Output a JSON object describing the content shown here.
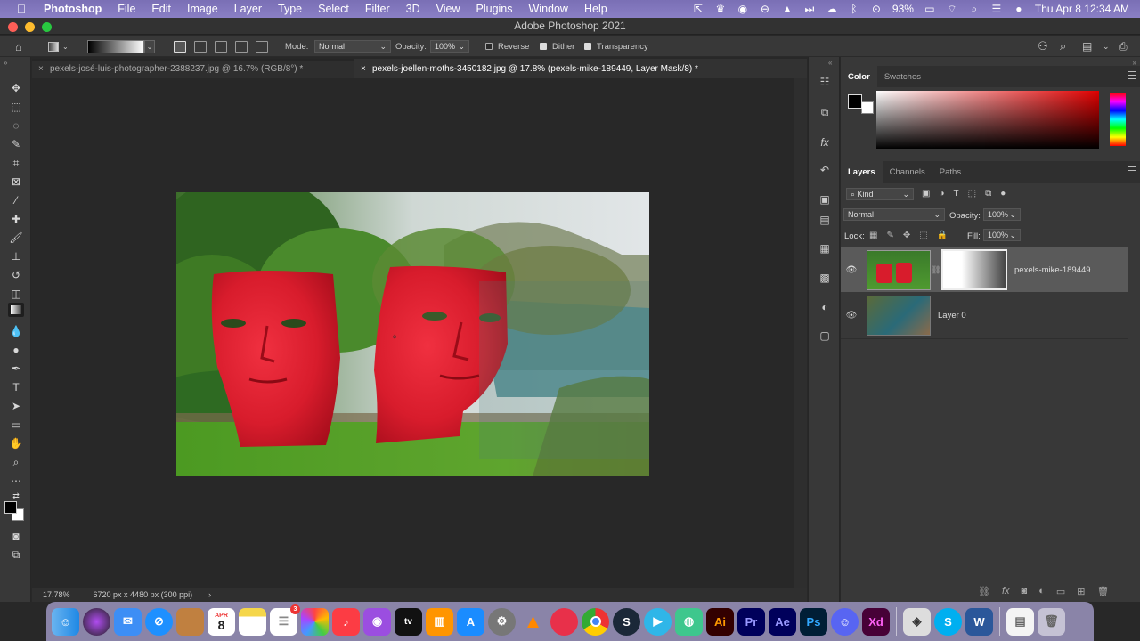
{
  "menubar": {
    "app": "Photoshop",
    "items": [
      "File",
      "Edit",
      "Image",
      "Layer",
      "Type",
      "Select",
      "Filter",
      "3D",
      "View",
      "Plugins",
      "Window",
      "Help"
    ],
    "battery": "93%",
    "datetime": "Thu Apr 8  12:34 AM"
  },
  "window": {
    "title": "Adobe Photoshop 2021"
  },
  "options": {
    "mode_label": "Mode:",
    "mode_value": "Normal",
    "opacity_label": "Opacity:",
    "opacity_value": "100%",
    "reverse": "Reverse",
    "dither": "Dither",
    "transparency": "Transparency",
    "reverse_checked": false,
    "dither_checked": true,
    "transparency_checked": true
  },
  "tabs": [
    {
      "label": "pexels-josé-luis-photographer-2388237.jpg @ 16.7% (RGB/8°) *"
    },
    {
      "label": "pexels-joellen-moths-3450182.jpg @ 17.8% (pexels-mike-189449, Layer Mask/8) *"
    }
  ],
  "status": {
    "zoom": "17.78%",
    "doc_info": "6720 px x 4480 px (300 ppi)",
    "arrow": "›"
  },
  "color_panel": {
    "tabs": [
      "Color",
      "Swatches"
    ],
    "active": "Color"
  },
  "layers_panel": {
    "tabs": [
      "Layers",
      "Channels",
      "Paths"
    ],
    "active": "Layers",
    "kind": "Kind",
    "blend": "Normal",
    "opacity_label": "Opacity:",
    "opacity_value": "100%",
    "lock_label": "Lock:",
    "fill_label": "Fill:",
    "fill_value": "100%",
    "layers": [
      {
        "name": "pexels-mike-189449",
        "selected": true
      },
      {
        "name": "Layer 0",
        "selected": false
      }
    ]
  },
  "dock": {
    "calendar_month": "APR",
    "calendar_day": "8",
    "reminders_badge": "3",
    "apps": [
      "Finder",
      "Siri",
      "Mail",
      "Safari",
      "Pages",
      "Calendar",
      "Notes",
      "Reminders",
      "Photos",
      "Music",
      "Podcasts",
      "TV",
      "Books",
      "App Store",
      "System Preferences",
      "VLC",
      "Ninja",
      "Chrome",
      "Steam",
      "Vidmore",
      "Screen",
      "Illustrator",
      "Premiere Pro",
      "After Effects",
      "Photoshop",
      "Discord",
      "Adobe XD",
      "Ocenaudio",
      "Skype",
      "Word",
      "Preview",
      "Trash"
    ],
    "labels": {
      "ai": "Ai",
      "pr": "Pr",
      "ae": "Ae",
      "ps": "Ps",
      "xd": "Xd",
      "word": "W",
      "skype": "S"
    }
  },
  "colors": {
    "accent_bar": "#8a7fc5",
    "fg_swatch": "#000000",
    "bg_swatch": "#ffffff"
  }
}
